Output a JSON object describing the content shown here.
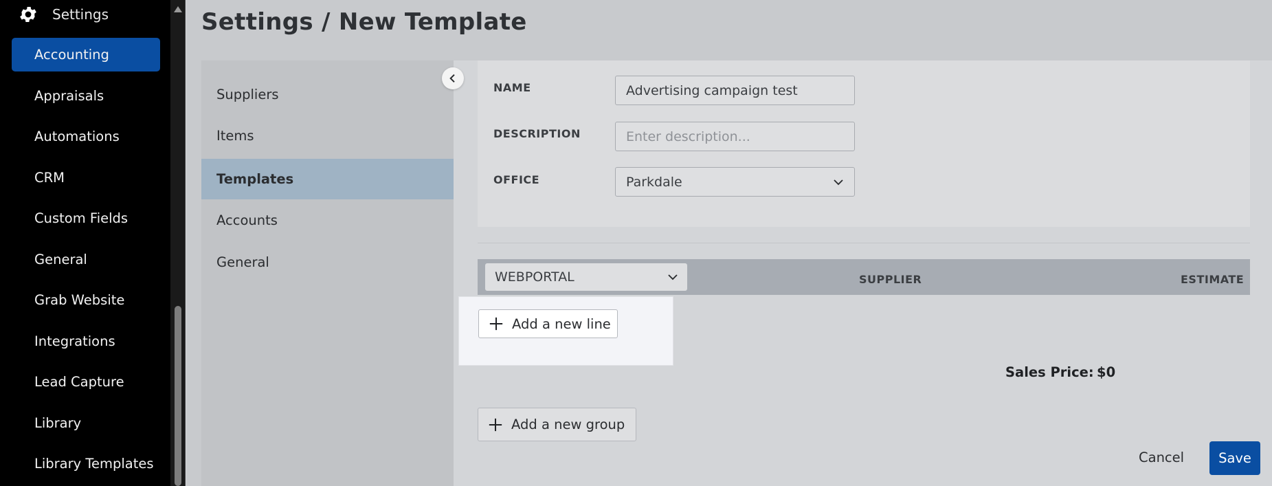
{
  "sidebar": {
    "header_label": "Settings",
    "items": [
      {
        "label": "Accounting",
        "active": true
      },
      {
        "label": "Appraisals"
      },
      {
        "label": "Automations"
      },
      {
        "label": "CRM"
      },
      {
        "label": "Custom Fields"
      },
      {
        "label": "General"
      },
      {
        "label": "Grab Website"
      },
      {
        "label": "Integrations"
      },
      {
        "label": "Lead Capture"
      },
      {
        "label": "Library"
      },
      {
        "label": "Library Templates"
      }
    ]
  },
  "page": {
    "title": "Settings / New Template"
  },
  "subnav": {
    "items": [
      {
        "label": "Suppliers"
      },
      {
        "label": "Items"
      },
      {
        "label": "Templates",
        "active": true
      },
      {
        "label": "Accounts"
      },
      {
        "label": "General"
      }
    ]
  },
  "form": {
    "name_label": "NAME",
    "name_value": "Advertising campaign test",
    "description_label": "DESCRIPTION",
    "description_placeholder": "Enter description...",
    "office_label": "OFFICE",
    "office_value": "Parkdale"
  },
  "group": {
    "select_value": "WEBPORTAL",
    "col_supplier": "SUPPLIER",
    "col_estimate": "ESTIMATE",
    "add_line_label": "Add a new line"
  },
  "summary": {
    "sales_price_label": "Sales Price:",
    "sales_price_value": "$0"
  },
  "actions": {
    "add_group_label": "Add a new group",
    "cancel_label": "Cancel",
    "save_label": "Save"
  },
  "colors": {
    "accent": "#0a4ea2",
    "active_subnav": "#9fb3c4"
  }
}
